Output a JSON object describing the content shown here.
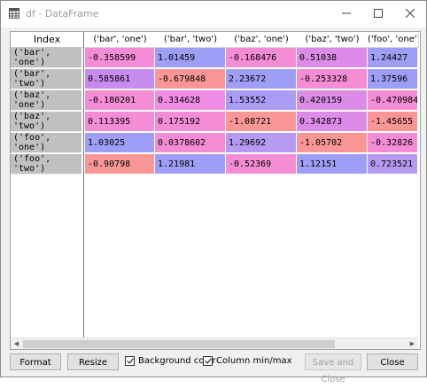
{
  "window": {
    "title": "df - DataFrame"
  },
  "index_header": "Index",
  "index_labels": [
    [
      "('bar',",
      "'one')"
    ],
    [
      "('bar',",
      "'two')"
    ],
    [
      "('baz',",
      "'one')"
    ],
    [
      "('baz',",
      "'two')"
    ],
    [
      "('foo',",
      "'one')"
    ],
    [
      "('foo',",
      "'two')"
    ]
  ],
  "columns": [
    "('bar', 'one')",
    "('bar', 'two')",
    "('baz', 'one')",
    "('baz', 'two')",
    "('foo', 'one')"
  ],
  "rows": [
    [
      "-0.358599",
      "1.01459",
      "-0.168476",
      "0.51038",
      "1.24427"
    ],
    [
      "0.585861",
      "-0.679848",
      "2.23672",
      "-0.253328",
      "1.37596"
    ],
    [
      "-0.180201",
      "0.334628",
      "1.53552",
      "0.420159",
      "-0.470984"
    ],
    [
      "0.113395",
      "0.175192",
      "-1.08721",
      "0.342873",
      "-1.45655"
    ],
    [
      "1.03025",
      "0.0378602",
      "1.29692",
      "-1.05702",
      "-0.32826"
    ],
    [
      "-0.90798",
      "1.21981",
      "-0.52369",
      "1.12151",
      "0.723521"
    ]
  ],
  "cell_colors": [
    [
      "#f58cd6",
      "#9e9ef6",
      "#f58cd6",
      "#dc8ce8",
      "#9e9ef6"
    ],
    [
      "#c88cf0",
      "#fa9696",
      "#9e9ef6",
      "#f58cd6",
      "#9e9ef6"
    ],
    [
      "#f58cd6",
      "#f08ce6",
      "#a99cf5",
      "#dc8ce8",
      "#f58cd6"
    ],
    [
      "#f58cd6",
      "#f58cd6",
      "#fa9696",
      "#dc8ce8",
      "#fa9696"
    ],
    [
      "#9e9ef6",
      "#f58cd6",
      "#b69af2",
      "#fa9696",
      "#f58cd6"
    ],
    [
      "#fa9696",
      "#9e9ef6",
      "#f58cd6",
      "#9e9ef6",
      "#b69af2"
    ]
  ],
  "buttons": {
    "format": "Format",
    "resize": "Resize",
    "save_close": "Save and Close",
    "close": "Close"
  },
  "checks": {
    "background_color": "Background color",
    "column_minmax": "Column min/max"
  },
  "icons": {
    "app": "table-icon",
    "minimize": "minimize-icon",
    "maximize": "maximize-icon",
    "close": "close-icon"
  }
}
